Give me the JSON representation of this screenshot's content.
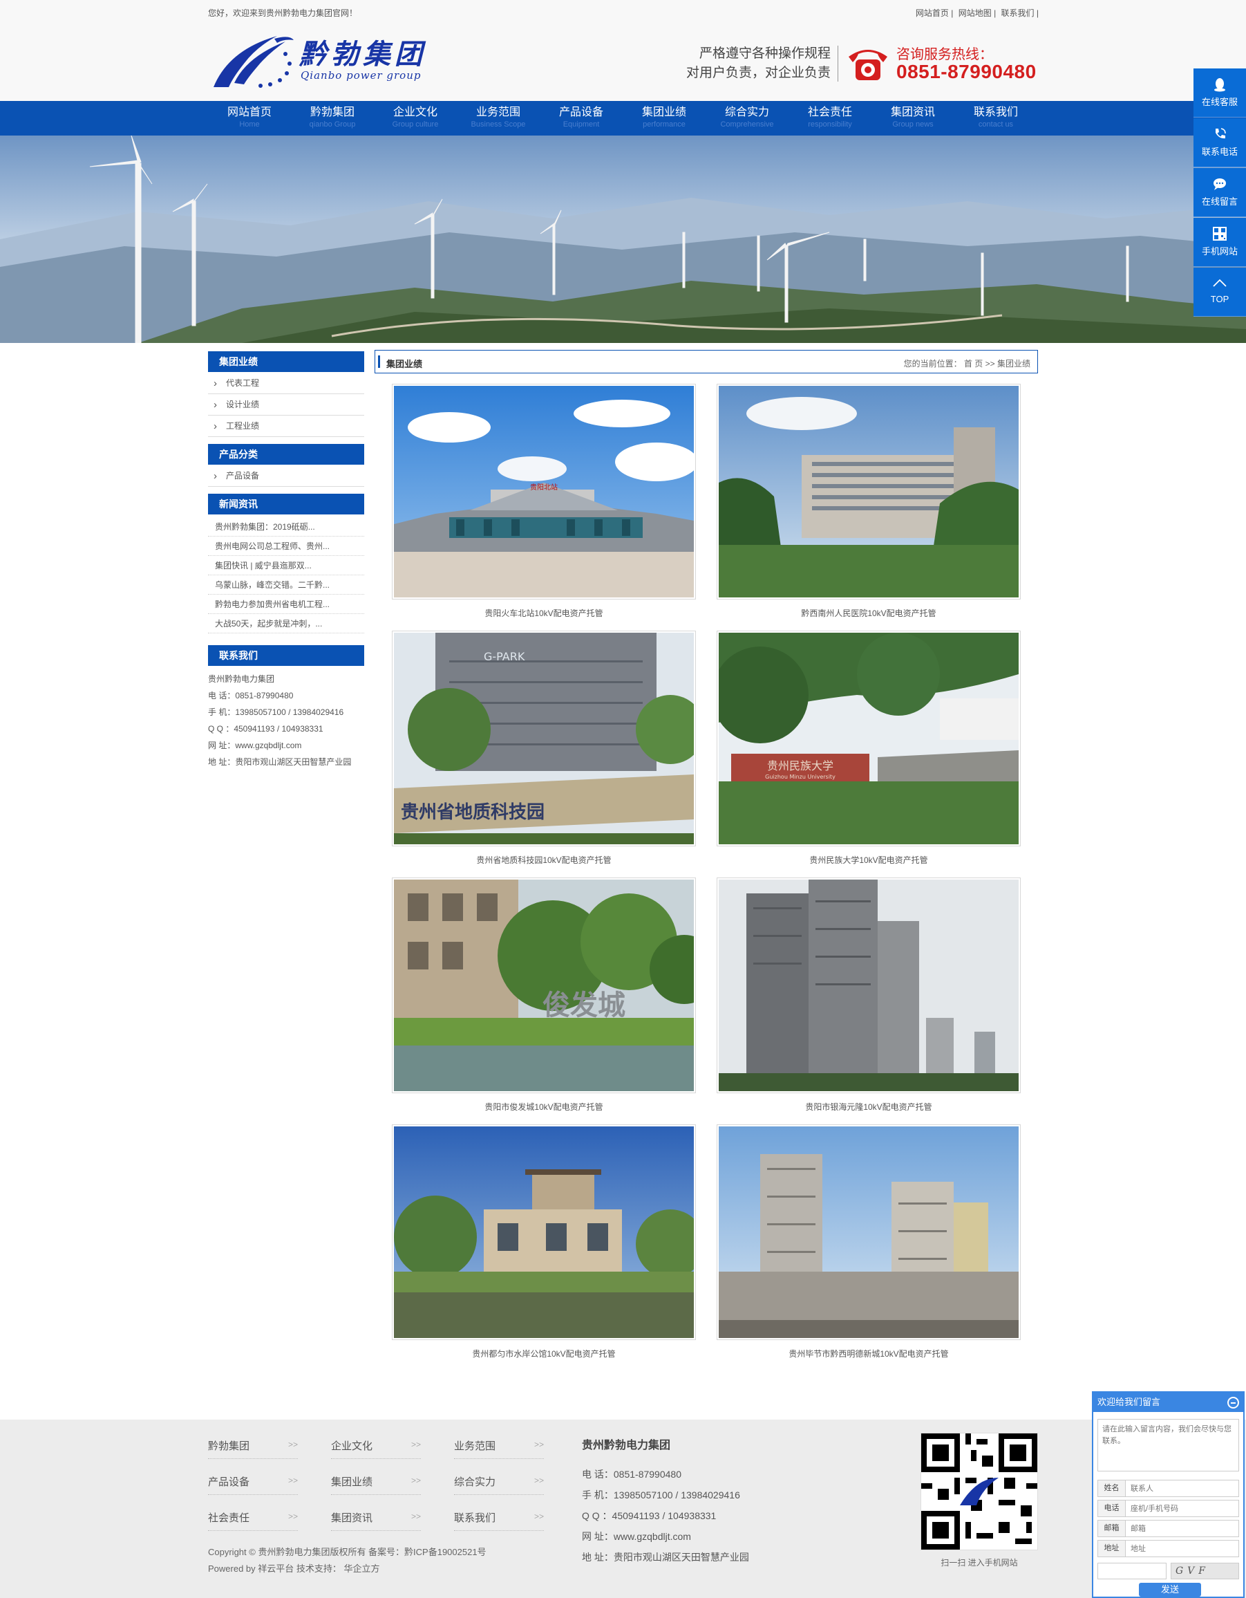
{
  "topbar": {
    "welcome": "您好，欢迎来到贵州黔勃电力集团官网！",
    "links": [
      "网站首页",
      "网站地图",
      "联系我们"
    ]
  },
  "header": {
    "logo_text": "黔勃集团",
    "logo_sub": "Qianbo power group",
    "slogan_line1": "严格遵守各种操作规程",
    "slogan_line2": "对用户负责，对企业负责",
    "hotline_label": "咨询服务热线：",
    "hotline_number": "0851-87990480"
  },
  "nav": [
    {
      "zh": "网站首页",
      "en": "Home"
    },
    {
      "zh": "黔勃集团",
      "en": "qianbo Group"
    },
    {
      "zh": "企业文化",
      "en": "Group culture"
    },
    {
      "zh": "业务范围",
      "en": "Business Scope"
    },
    {
      "zh": "产品设备",
      "en": "Equipment"
    },
    {
      "zh": "集团业绩",
      "en": "performance"
    },
    {
      "zh": "综合实力",
      "en": "Comprehensive"
    },
    {
      "zh": "社会责任",
      "en": "responsibility"
    },
    {
      "zh": "集团资讯",
      "en": "Group news"
    },
    {
      "zh": "联系我们",
      "en": "contact us"
    }
  ],
  "sidebar": {
    "performance": {
      "title": "集团业绩",
      "items": [
        "代表工程",
        "设计业绩",
        "工程业绩"
      ]
    },
    "products": {
      "title": "产品分类",
      "items": [
        "产品设备"
      ]
    },
    "news": {
      "title": "新闻资讯",
      "items": [
        "贵州黔勃集团：2019砥砺...",
        "贵州电网公司总工程师、贵州...",
        "集团快讯 | 威宁县迤那双...",
        "乌蒙山脉，峰峦交错。二千黔...",
        "黔勃电力参加贵州省电机工程...",
        "大战50天，起步就是冲刺，..."
      ]
    },
    "contact": {
      "title": "联系我们",
      "lines": [
        "贵州黔勃电力集团",
        "电 话：0851-87990480",
        "手 机：13985057100 / 13984029416",
        "Q Q ：450941193 / 104938331",
        "网 址：www.gzqbdljt.com",
        "地 址：贵阳市观山湖区天田智慧产业园"
      ]
    }
  },
  "breadcrumb": {
    "title": "集团业绩",
    "prefix": "您的当前位置：",
    "home": "首 页",
    "sep": ">>",
    "current": "集团业绩"
  },
  "projects": [
    {
      "caption": "贵阳火车北站10kV配电资产托管",
      "icon": "train-station-photo"
    },
    {
      "caption": "黔西南州人民医院10kV配电资产托管",
      "icon": "hospital-photo"
    },
    {
      "caption": "贵州省地质科技园10kV配电资产托管",
      "icon": "tech-park-photo"
    },
    {
      "caption": "贵州民族大学10kV配电资产托管",
      "icon": "university-photo"
    },
    {
      "caption": "贵阳市俊发城10kV配电资产托管",
      "icon": "residential-photo"
    },
    {
      "caption": "贵阳市银海元隆10kV配电资产托管",
      "icon": "highrise-photo"
    },
    {
      "caption": "贵州都匀市水岸公馆10kV配电资产托管",
      "icon": "villa-photo"
    },
    {
      "caption": "贵州毕节市黔西明德新城10kV配电资产托管",
      "icon": "apartment-photo"
    }
  ],
  "photo_text": {
    "station_sign": "贵阳北站",
    "park_sign": "G-PARK",
    "geo_sign": "贵州省地质科技园",
    "univ_sign": "贵州民族大学",
    "univ_sign_en": "Guizhou Minzu University",
    "residence_sign": "俊发城"
  },
  "footer": {
    "links": [
      "黔勃集团",
      "企业文化",
      "业务范围",
      "产品设备",
      "集团业绩",
      "综合实力",
      "社会责任",
      "集团资讯",
      "联系我们"
    ],
    "arrow": ">>",
    "copyright": "Copyright © 贵州黔勃电力集团版权所有 备案号：黔ICP备19002521号",
    "powered": "Powered by 祥云平台  技术支持： 华企立方",
    "company": "贵州黔勃电力集团",
    "contact_lines": [
      "电 话：0851-87990480",
      "手 机：13985057100 / 13984029416",
      "Q Q ：450941193 / 104938331",
      "网 址：www.gzqbdljt.com",
      "地 址：贵阳市观山湖区天田智慧产业园"
    ],
    "qr_caption": "扫一扫 进入手机网站"
  },
  "floatbar": [
    {
      "label": "在线客服",
      "icon": "qq-icon"
    },
    {
      "label": "联系电话",
      "icon": "phone-icon"
    },
    {
      "label": "在线留言",
      "icon": "chat-icon"
    },
    {
      "label": "手机网站",
      "icon": "qrcode-icon"
    },
    {
      "label": "TOP",
      "icon": "arrow-up-icon"
    }
  ],
  "message_box": {
    "title": "欢迎给我们留言",
    "content_placeholder": "请在此输入留言内容，我们会尽快与您联系。",
    "name_label": "姓名",
    "name_placeholder": "联系人",
    "phone_label": "电话",
    "phone_placeholder": "座机/手机号码",
    "email_label": "邮箱",
    "email_placeholder": "邮箱",
    "address_label": "地址",
    "address_placeholder": "地址",
    "captcha": "GVF",
    "send": "发送"
  },
  "colors": {
    "brand_blue": "#0a52b3",
    "hotline_red": "#d41f1f",
    "float_blue": "#0a6cd6"
  }
}
